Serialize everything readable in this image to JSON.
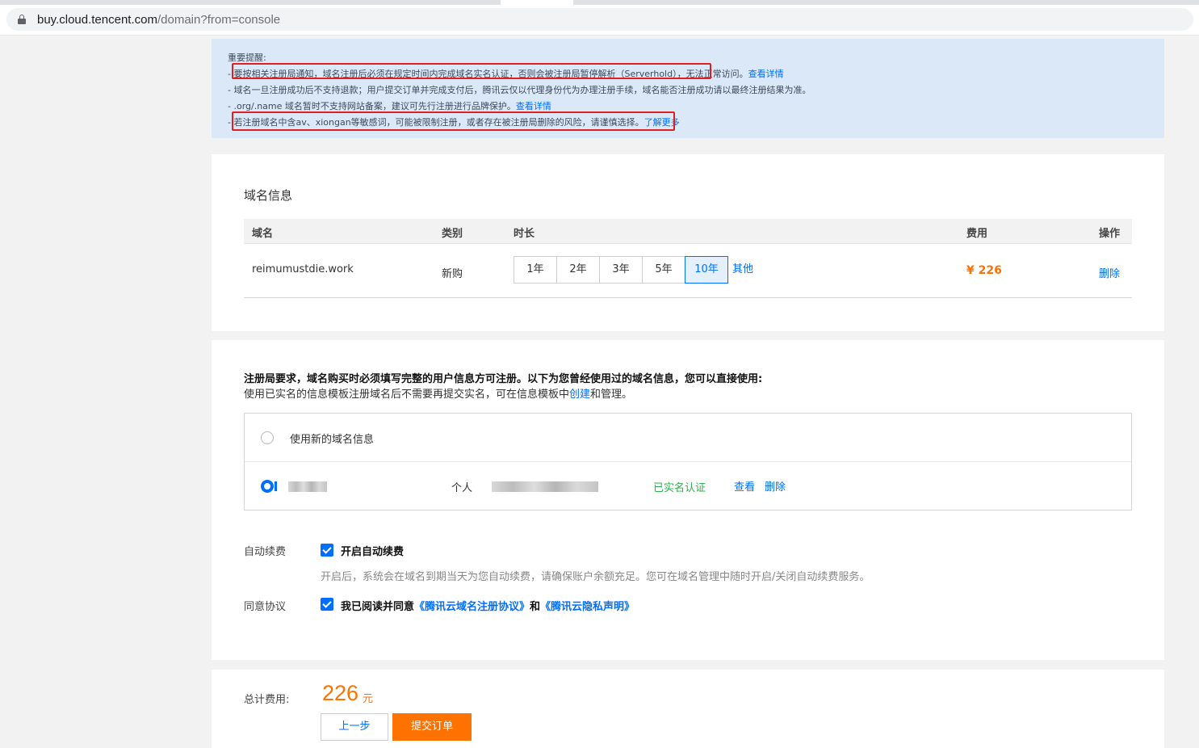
{
  "browser": {
    "url_host": "buy.cloud.tencent.com",
    "url_path": "/domain?from=console"
  },
  "notice": {
    "title": "重要提醒:",
    "lines": [
      {
        "prefix": "- ",
        "text": "要按相关注册局通知，域名注册后必须在规定时间内完成域名实名认证，否则会被注册局暂停解析（Serverhold），无法正常访问。",
        "link": "查看详情"
      },
      {
        "prefix": "- ",
        "text": "域名一旦注册成功后不支持退款；用户提交订单并完成支付后，腾讯云仅以代理身份代为办理注册手续，域名能否注册成功请以最终注册结果为准。",
        "link": ""
      },
      {
        "prefix": "- ",
        "text": ".org/.name 域名暂时不支持网站备案，建议可先行注册进行品牌保护。",
        "link": "查看详情"
      },
      {
        "prefix": "- ",
        "text": "若注册域名中含av、xiongan等敏感词，可能被限制注册，或者存在被注册局删除的风险，请谨慎选择。",
        "link": "了解更多"
      }
    ]
  },
  "domain_section": {
    "title": "域名信息",
    "headers": {
      "domain": "域名",
      "type": "类别",
      "duration": "时长",
      "fee": "费用",
      "action": "操作"
    },
    "row": {
      "domain": "reimumustdie.work",
      "type": "新购",
      "durations": [
        "1年",
        "2年",
        "3年",
        "5年",
        "10年"
      ],
      "selected_duration": "10年",
      "other": "其他",
      "price": "¥ 226",
      "delete": "删除"
    }
  },
  "info_section": {
    "notice_strong": "注册局要求，域名购买时必须填写完整的用户信息方可注册。以下为您曾经使用过的域名信息，您可以直接使用:",
    "notice_sub_before": "使用已实名的信息模板注册域名后不需要再提交实名，可在信息模板中",
    "notice_sub_link": "创建",
    "notice_sub_after": "和管理。",
    "new_info_label": "使用新的域名信息",
    "template": {
      "owner_type": "个人",
      "status": "已实名认证",
      "view": "查看",
      "delete": "删除"
    },
    "auto_renew": {
      "label": "自动续费",
      "checkbox_label": "开启自动续费",
      "hint": "开启后，系统会在域名到期当天为您自动续费，请确保账户余额充足。您可在域名管理中随时开启/关闭自动续费服务。"
    },
    "agreement": {
      "label": "同意协议",
      "prefix": "我已阅读并同意",
      "link1": "《腾讯云域名注册协议》",
      "middle": "和",
      "link2": "《腾讯云隐私声明》"
    }
  },
  "total": {
    "label": "总计费用:",
    "amount": "226",
    "unit": "元",
    "prev_button": "上一步",
    "submit_button": "提交订单"
  },
  "colors": {
    "accent": "#006eff",
    "price": "#ff7200",
    "verified": "#2ab04b",
    "highlight_box": "#e02020"
  }
}
